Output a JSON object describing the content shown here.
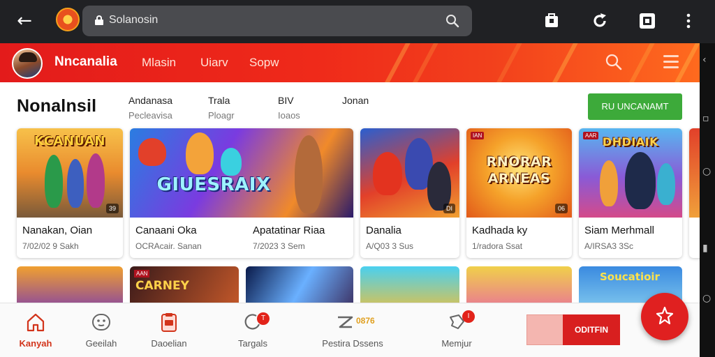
{
  "browser": {
    "url_text": "Solanosin"
  },
  "header": {
    "brand": "Nncanalia",
    "nav": [
      "Mlasin",
      "Uiarv",
      "Sopw"
    ]
  },
  "page": {
    "title": "Nonalnsil",
    "filters": [
      {
        "label": "Andanasa",
        "sub": "Pecleavisa"
      },
      {
        "label": "Trala",
        "sub": "Ploagr"
      },
      {
        "label": "BIV",
        "sub": "Ioaos"
      },
      {
        "label": "Jonan",
        "sub": ""
      }
    ],
    "cta_label": "RU UNCANAMT"
  },
  "games": [
    {
      "title": "Nanakan, Oian",
      "sub": "7/02/02 9 Sakh",
      "banner": "KCANUAN",
      "tag": "",
      "count": "39"
    },
    {
      "title": "Canaani Oka",
      "sub": "OCRAcair. Sanan",
      "banner": "GIUESRAIX",
      "tag": "",
      "count": ""
    },
    {
      "title": "Apatatinar Riaa",
      "sub": "7/2023 3 Sem",
      "banner": "",
      "tag": "",
      "count": ""
    },
    {
      "title": "Danalia",
      "sub": "A/Q03 3 Sus",
      "banner": "",
      "tag": "",
      "count": "DI"
    },
    {
      "title": "Kadhada ky",
      "sub": "1/radora Ssat",
      "banner": "RNORAR ARNEAS",
      "tag": "IAN",
      "count": "06"
    },
    {
      "title": "Siam Merhmall",
      "sub": "A/IRSA3 3Sc",
      "banner": "DHDIAIK",
      "tag": "AAR",
      "count": ""
    }
  ],
  "row2": [
    {
      "banner": "",
      "tag": ""
    },
    {
      "banner": "CARNEY",
      "tag": "AAN"
    },
    {
      "banner": "",
      "tag": ""
    },
    {
      "banner": "",
      "tag": ""
    },
    {
      "banner": "",
      "tag": ""
    },
    {
      "banner": "Soucatioir",
      "tag": ""
    }
  ],
  "bottom_nav": {
    "tabs": [
      {
        "label": "Kanyah",
        "icon": "home-icon",
        "active": true
      },
      {
        "label": "Geeilah",
        "icon": "gamepad-icon"
      },
      {
        "label": "Daoelian",
        "icon": "clipboard-icon"
      },
      {
        "label": "Targals",
        "icon": "refresh-icon",
        "badge": "T"
      },
      {
        "label": "Pestira Dssens",
        "icon": "zigzag-icon",
        "extra": "0876"
      },
      {
        "label": "Memjur",
        "icon": "chat-icon",
        "badge": "I"
      }
    ],
    "play_label": "ODITFIN"
  },
  "colors": {
    "header_red": "#e31b1b",
    "cta_green": "#3daa3a",
    "accent_red": "#d81f1f"
  }
}
